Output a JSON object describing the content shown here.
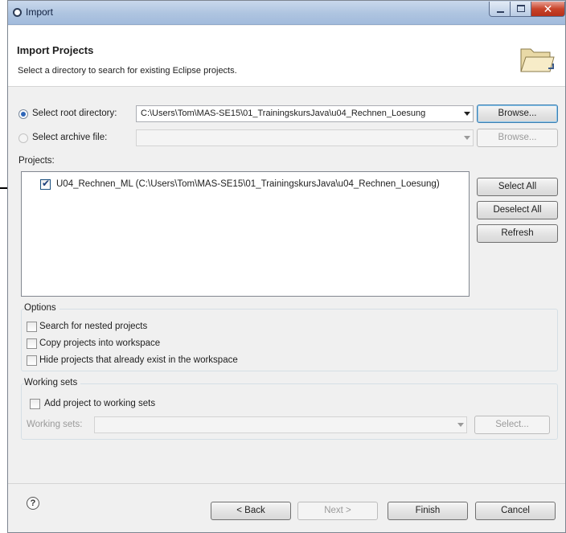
{
  "window": {
    "title": "Import"
  },
  "header": {
    "title": "Import Projects",
    "subtitle": "Select a directory to search for existing Eclipse projects."
  },
  "source": {
    "root_label": "Select root directory:",
    "root_path": "C:\\Users\\Tom\\MAS-SE15\\01_TrainingskursJava\\u04_Rechnen_Loesung",
    "root_browse": "Browse...",
    "archive_label": "Select archive file:",
    "archive_path": "",
    "archive_browse": "Browse..."
  },
  "projects": {
    "label": "Projects:",
    "items": [
      {
        "label": "U04_Rechnen_ML  (C:\\Users\\Tom\\MAS-SE15\\01_TrainingskursJava\\u04_Rechnen_Loesung)",
        "checked": true
      }
    ],
    "select_all": "Select All",
    "deselect_all": "Deselect All",
    "refresh": "Refresh"
  },
  "options": {
    "title": "Options",
    "nested": "Search for nested projects",
    "copy": "Copy projects into workspace",
    "hide": "Hide projects that already exist in the workspace"
  },
  "working_sets": {
    "title": "Working sets",
    "add": "Add project to working sets",
    "label": "Working sets:",
    "value": "",
    "select": "Select..."
  },
  "footer": {
    "help": "?",
    "back": "< Back",
    "next": "Next >",
    "finish": "Finish",
    "cancel": "Cancel"
  }
}
